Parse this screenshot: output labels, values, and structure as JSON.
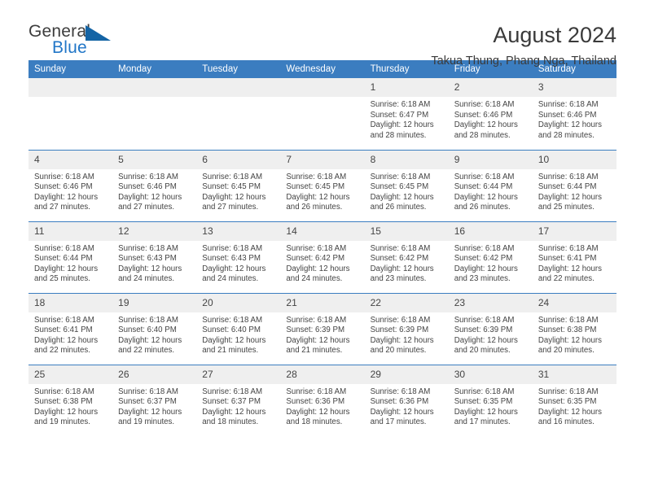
{
  "logo": {
    "word_top": "General",
    "word_bottom": "Blue",
    "triangle_color": "#1464a5",
    "blue_color": "#2176c7"
  },
  "header": {
    "title": "August 2024",
    "subtitle": "Takua Thung, Phang Nga, Thailand",
    "header_bg": "#3b7dc0",
    "header_text_color": "#ffffff",
    "daynum_bg": "#efefef"
  },
  "weekday_headers": [
    "Sunday",
    "Monday",
    "Tuesday",
    "Wednesday",
    "Thursday",
    "Friday",
    "Saturday"
  ],
  "labels": {
    "sunrise_prefix": "Sunrise:",
    "sunset_prefix": "Sunset:",
    "daylight_prefix": "Daylight:"
  },
  "weeks": [
    [
      {
        "day": "",
        "empty": true
      },
      {
        "day": "",
        "empty": true
      },
      {
        "day": "",
        "empty": true
      },
      {
        "day": "",
        "empty": true
      },
      {
        "day": "1",
        "sunrise": "Sunrise: 6:18 AM",
        "sunset": "Sunset: 6:47 PM",
        "daylight": "Daylight: 12 hours and 28 minutes."
      },
      {
        "day": "2",
        "sunrise": "Sunrise: 6:18 AM",
        "sunset": "Sunset: 6:46 PM",
        "daylight": "Daylight: 12 hours and 28 minutes."
      },
      {
        "day": "3",
        "sunrise": "Sunrise: 6:18 AM",
        "sunset": "Sunset: 6:46 PM",
        "daylight": "Daylight: 12 hours and 28 minutes."
      }
    ],
    [
      {
        "day": "4",
        "sunrise": "Sunrise: 6:18 AM",
        "sunset": "Sunset: 6:46 PM",
        "daylight": "Daylight: 12 hours and 27 minutes."
      },
      {
        "day": "5",
        "sunrise": "Sunrise: 6:18 AM",
        "sunset": "Sunset: 6:46 PM",
        "daylight": "Daylight: 12 hours and 27 minutes."
      },
      {
        "day": "6",
        "sunrise": "Sunrise: 6:18 AM",
        "sunset": "Sunset: 6:45 PM",
        "daylight": "Daylight: 12 hours and 27 minutes."
      },
      {
        "day": "7",
        "sunrise": "Sunrise: 6:18 AM",
        "sunset": "Sunset: 6:45 PM",
        "daylight": "Daylight: 12 hours and 26 minutes."
      },
      {
        "day": "8",
        "sunrise": "Sunrise: 6:18 AM",
        "sunset": "Sunset: 6:45 PM",
        "daylight": "Daylight: 12 hours and 26 minutes."
      },
      {
        "day": "9",
        "sunrise": "Sunrise: 6:18 AM",
        "sunset": "Sunset: 6:44 PM",
        "daylight": "Daylight: 12 hours and 26 minutes."
      },
      {
        "day": "10",
        "sunrise": "Sunrise: 6:18 AM",
        "sunset": "Sunset: 6:44 PM",
        "daylight": "Daylight: 12 hours and 25 minutes."
      }
    ],
    [
      {
        "day": "11",
        "sunrise": "Sunrise: 6:18 AM",
        "sunset": "Sunset: 6:44 PM",
        "daylight": "Daylight: 12 hours and 25 minutes."
      },
      {
        "day": "12",
        "sunrise": "Sunrise: 6:18 AM",
        "sunset": "Sunset: 6:43 PM",
        "daylight": "Daylight: 12 hours and 24 minutes."
      },
      {
        "day": "13",
        "sunrise": "Sunrise: 6:18 AM",
        "sunset": "Sunset: 6:43 PM",
        "daylight": "Daylight: 12 hours and 24 minutes."
      },
      {
        "day": "14",
        "sunrise": "Sunrise: 6:18 AM",
        "sunset": "Sunset: 6:42 PM",
        "daylight": "Daylight: 12 hours and 24 minutes."
      },
      {
        "day": "15",
        "sunrise": "Sunrise: 6:18 AM",
        "sunset": "Sunset: 6:42 PM",
        "daylight": "Daylight: 12 hours and 23 minutes."
      },
      {
        "day": "16",
        "sunrise": "Sunrise: 6:18 AM",
        "sunset": "Sunset: 6:42 PM",
        "daylight": "Daylight: 12 hours and 23 minutes."
      },
      {
        "day": "17",
        "sunrise": "Sunrise: 6:18 AM",
        "sunset": "Sunset: 6:41 PM",
        "daylight": "Daylight: 12 hours and 22 minutes."
      }
    ],
    [
      {
        "day": "18",
        "sunrise": "Sunrise: 6:18 AM",
        "sunset": "Sunset: 6:41 PM",
        "daylight": "Daylight: 12 hours and 22 minutes."
      },
      {
        "day": "19",
        "sunrise": "Sunrise: 6:18 AM",
        "sunset": "Sunset: 6:40 PM",
        "daylight": "Daylight: 12 hours and 22 minutes."
      },
      {
        "day": "20",
        "sunrise": "Sunrise: 6:18 AM",
        "sunset": "Sunset: 6:40 PM",
        "daylight": "Daylight: 12 hours and 21 minutes."
      },
      {
        "day": "21",
        "sunrise": "Sunrise: 6:18 AM",
        "sunset": "Sunset: 6:39 PM",
        "daylight": "Daylight: 12 hours and 21 minutes."
      },
      {
        "day": "22",
        "sunrise": "Sunrise: 6:18 AM",
        "sunset": "Sunset: 6:39 PM",
        "daylight": "Daylight: 12 hours and 20 minutes."
      },
      {
        "day": "23",
        "sunrise": "Sunrise: 6:18 AM",
        "sunset": "Sunset: 6:39 PM",
        "daylight": "Daylight: 12 hours and 20 minutes."
      },
      {
        "day": "24",
        "sunrise": "Sunrise: 6:18 AM",
        "sunset": "Sunset: 6:38 PM",
        "daylight": "Daylight: 12 hours and 20 minutes."
      }
    ],
    [
      {
        "day": "25",
        "sunrise": "Sunrise: 6:18 AM",
        "sunset": "Sunset: 6:38 PM",
        "daylight": "Daylight: 12 hours and 19 minutes."
      },
      {
        "day": "26",
        "sunrise": "Sunrise: 6:18 AM",
        "sunset": "Sunset: 6:37 PM",
        "daylight": "Daylight: 12 hours and 19 minutes."
      },
      {
        "day": "27",
        "sunrise": "Sunrise: 6:18 AM",
        "sunset": "Sunset: 6:37 PM",
        "daylight": "Daylight: 12 hours and 18 minutes."
      },
      {
        "day": "28",
        "sunrise": "Sunrise: 6:18 AM",
        "sunset": "Sunset: 6:36 PM",
        "daylight": "Daylight: 12 hours and 18 minutes."
      },
      {
        "day": "29",
        "sunrise": "Sunrise: 6:18 AM",
        "sunset": "Sunset: 6:36 PM",
        "daylight": "Daylight: 12 hours and 17 minutes."
      },
      {
        "day": "30",
        "sunrise": "Sunrise: 6:18 AM",
        "sunset": "Sunset: 6:35 PM",
        "daylight": "Daylight: 12 hours and 17 minutes."
      },
      {
        "day": "31",
        "sunrise": "Sunrise: 6:18 AM",
        "sunset": "Sunset: 6:35 PM",
        "daylight": "Daylight: 12 hours and 16 minutes."
      }
    ]
  ]
}
